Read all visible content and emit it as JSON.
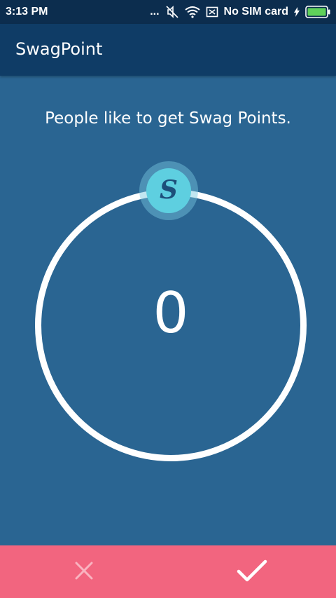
{
  "status_bar": {
    "time": "3:13 PM",
    "dots": "...",
    "sim_text": "No SIM card",
    "icons": [
      "mute-icon",
      "wifi-icon",
      "no-sim-icon",
      "charging-icon",
      "battery-icon"
    ]
  },
  "app_bar": {
    "title": "SwagPoint"
  },
  "main": {
    "tagline": "People like to get Swag Points.",
    "points_value": "0",
    "handle_letter": "S"
  },
  "actions": {
    "cancel_icon": "close-icon",
    "confirm_icon": "check-icon"
  },
  "colors": {
    "background": "#2a6592",
    "status_bar": "#0c2d4e",
    "app_bar": "#0f3c66",
    "handle": "#5ecfe0",
    "bottom_bar": "#f2657f"
  }
}
